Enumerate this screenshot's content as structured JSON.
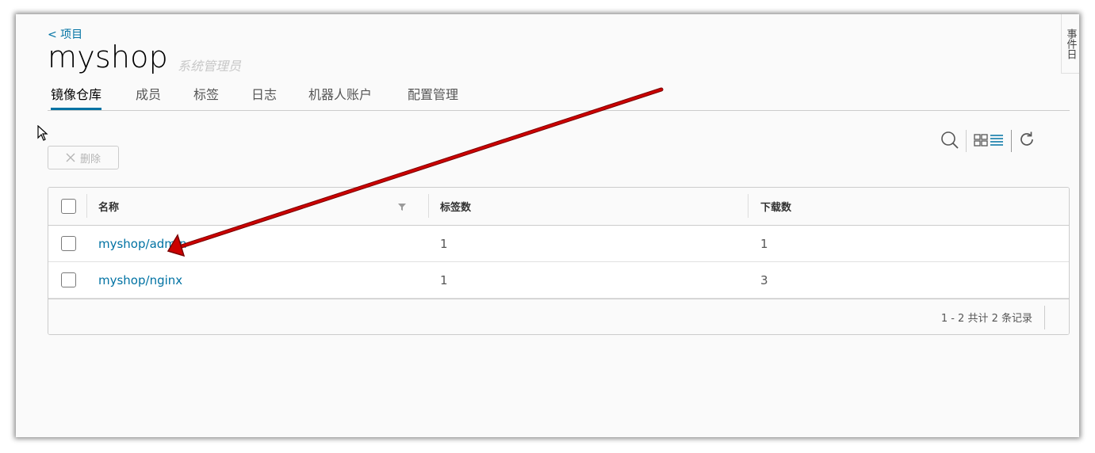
{
  "header": {
    "back_label": "< 项目",
    "project_name": "myshop",
    "role": "系统管理员",
    "side_tab_label": "事件日"
  },
  "tabs": [
    {
      "label": "镜像仓库",
      "active": true
    },
    {
      "label": "成员"
    },
    {
      "label": "标签"
    },
    {
      "label": "日志"
    },
    {
      "label": "机器人账户"
    },
    {
      "label": "配置管理"
    }
  ],
  "toolbar": {
    "delete_label": "删除",
    "icons": [
      "search-icon",
      "card-view-icon",
      "list-view-icon",
      "refresh-icon"
    ]
  },
  "table": {
    "columns": [
      "名称",
      "标签数",
      "下载数"
    ],
    "rows": [
      {
        "name": "myshop/admin",
        "tags": "1",
        "pulls": "1"
      },
      {
        "name": "myshop/nginx",
        "tags": "1",
        "pulls": "3"
      }
    ],
    "footer": "1 - 2 共计 2 条记录"
  },
  "colors": {
    "accent": "#0072a3",
    "annotation_arrow": "#cc0000"
  }
}
